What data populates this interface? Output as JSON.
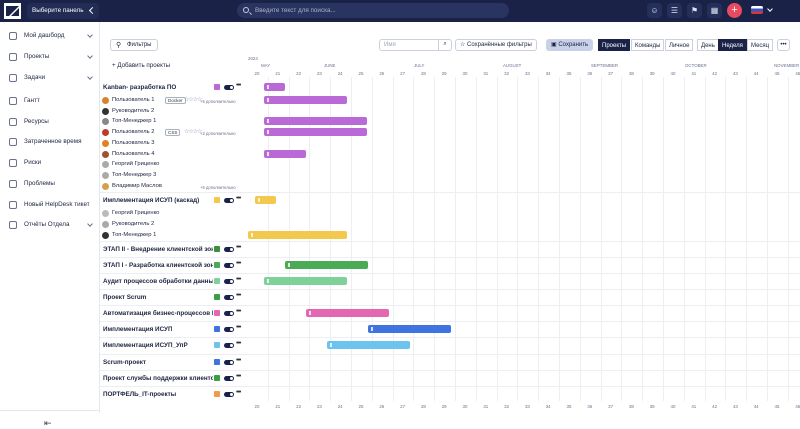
{
  "topbar": {
    "panel_label": "Выберите панель",
    "search_placeholder": "Введите текст для поиска..."
  },
  "colors": {
    "header_bg": "#1a2347",
    "accent": "#e84a5f"
  },
  "sidebar": {
    "items": [
      {
        "label": "Мой дашборд"
      },
      {
        "label": "Проекты"
      },
      {
        "label": "Задачи"
      },
      {
        "label": "Гантт"
      },
      {
        "label": "Ресурсы"
      },
      {
        "label": "Затраченное время"
      },
      {
        "label": "Риски"
      },
      {
        "label": "Проблемы"
      },
      {
        "label": "Новый HelpDesk тикет"
      },
      {
        "label": "Отчёты Отдела"
      }
    ],
    "collapse_icon": "collapse-left-icon"
  },
  "toolbar": {
    "filters": "Фильтры",
    "name_placeholder": "Имя",
    "saved_filters": "Сохранённые фильтры",
    "save": "Сохранить",
    "projects": "Проекты",
    "teams": "Команды",
    "personal": "Личное",
    "day": "День",
    "week": "Неделя",
    "month": "Месяц",
    "add_projects": "+ Добавить проекты"
  },
  "timeline": {
    "year": "2024",
    "months": [
      "MAY",
      "JUNE",
      "JULY",
      "AUGUST",
      "SEPTEMBER",
      "OCTOBER",
      "NOVEMBER"
    ],
    "weeks": [
      "20",
      "21",
      "22",
      "23",
      "24",
      "25",
      "26",
      "27",
      "28",
      "29",
      "30",
      "31",
      "32",
      "33",
      "34",
      "35",
      "36",
      "37",
      "38",
      "39",
      "40",
      "41",
      "42",
      "43",
      "44",
      "45",
      "46"
    ]
  },
  "projects": [
    {
      "name": "Kanban- разработка ПО",
      "color": "#b96ad6"
    },
    {
      "name": "Пользователь 1",
      "tag": "Docker",
      "more": "+5 дополнительно"
    },
    {
      "name": "Руководитель 2"
    },
    {
      "name": "Топ-Менеджер 1"
    },
    {
      "name": "Пользователь 2",
      "tag": "CSS",
      "more": "+2 дополнительно"
    },
    {
      "name": "Пользователь 3"
    },
    {
      "name": "Пользователь 4"
    },
    {
      "name": "Георгий Гриценко"
    },
    {
      "name": "Топ-Менеджер 3"
    },
    {
      "name": "Владимир Маслов",
      "more": "+5 дополнительно"
    },
    {
      "name": "Имплементация ИСУП (каскад)",
      "color": "#f2c94c"
    },
    {
      "name": "Георгий Гриценко"
    },
    {
      "name": "Руководитель 2"
    },
    {
      "name": "Топ-Менеджер 1"
    },
    {
      "name": "ЭТАП II - Внедрение клиентской зон...",
      "color": "#3a8f3e"
    },
    {
      "name": "ЭТАП I - Разработка клиентской зон...",
      "color": "#4bab55"
    },
    {
      "name": "Аудит процессов обработки данных...",
      "color": "#7fd19a"
    },
    {
      "name": "Проект Scrum",
      "color": "#3a9e44"
    },
    {
      "name": "Автоматизация бизнес-процессов К...",
      "color": "#e467b2"
    },
    {
      "name": "Имплементация ИСУП",
      "color": "#3f73e0"
    },
    {
      "name": "Имплементация ИСУП_УпР",
      "color": "#6cc3ef"
    },
    {
      "name": "Scrum-проект",
      "color": "#3f73e0"
    },
    {
      "name": "Проект службы поддержки клиентов",
      "color": "#3a9e44"
    },
    {
      "name": "ПОРТФЕЛЬ_IT-проекты",
      "color": "#f2994a"
    }
  ]
}
